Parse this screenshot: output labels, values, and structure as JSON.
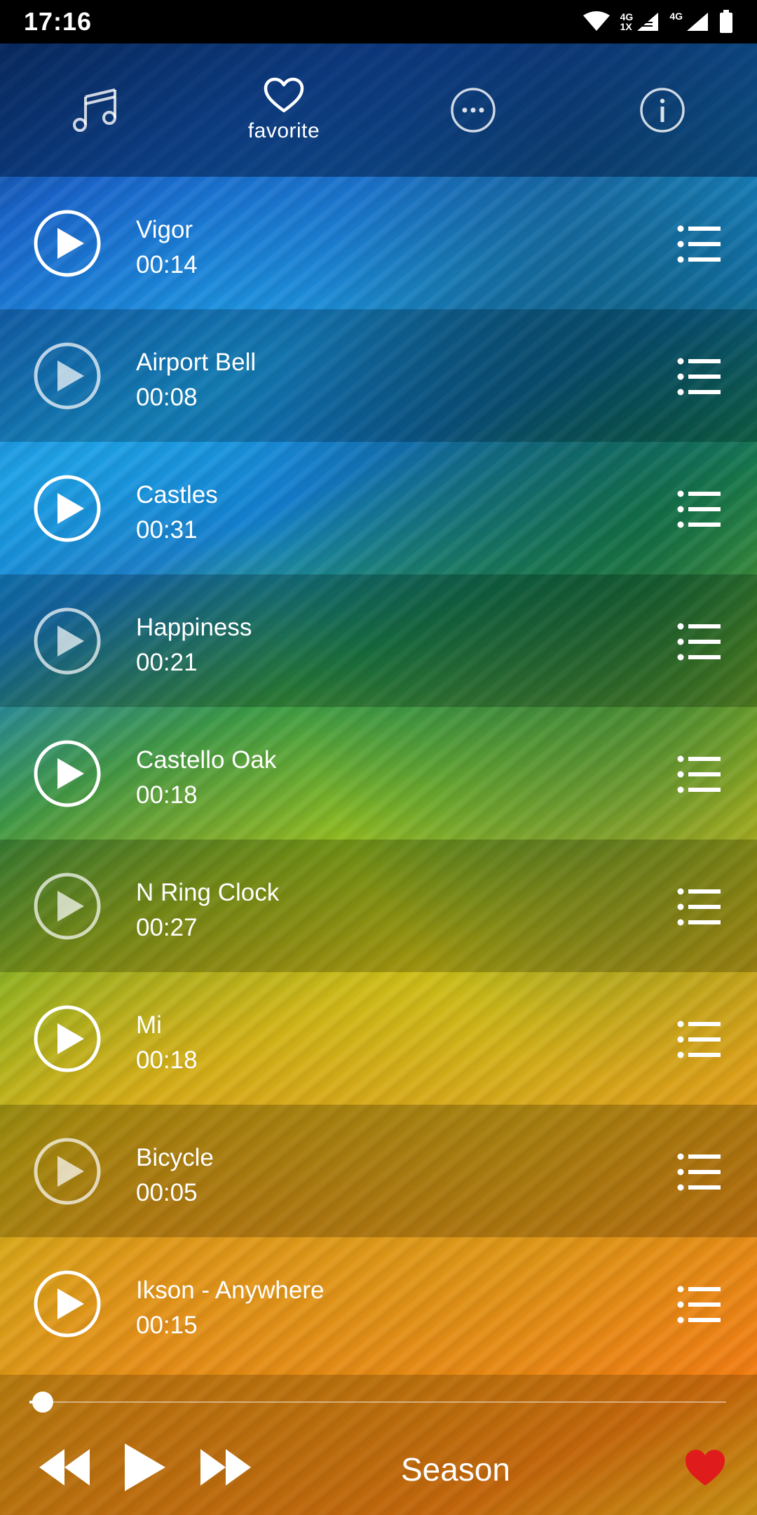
{
  "status_bar": {
    "time": "17:16",
    "network_1": "4G",
    "network_1_sub": "1X",
    "network_2": "4G",
    "icons": [
      "wifi-icon",
      "signal-icon",
      "signal-icon",
      "battery-icon"
    ]
  },
  "nav": {
    "items": [
      {
        "name": "music",
        "icon": "music-note-icon",
        "label": ""
      },
      {
        "name": "favorite",
        "icon": "heart-icon",
        "label": "favorite"
      },
      {
        "name": "more",
        "icon": "more-icon",
        "label": ""
      },
      {
        "name": "info",
        "icon": "info-icon",
        "label": ""
      }
    ]
  },
  "tracks": [
    {
      "title": "Vigor",
      "duration": "00:14"
    },
    {
      "title": "Airport Bell",
      "duration": "00:08"
    },
    {
      "title": "Castles",
      "duration": "00:31"
    },
    {
      "title": "Happiness",
      "duration": "00:21"
    },
    {
      "title": "Castello Oak",
      "duration": "00:18"
    },
    {
      "title": "N Ring Clock",
      "duration": "00:27"
    },
    {
      "title": "Mi",
      "duration": "00:18"
    },
    {
      "title": "Bicycle",
      "duration": "00:05"
    },
    {
      "title": "Ikson - Anywhere",
      "duration": "00:15"
    }
  ],
  "player": {
    "now_playing": "Season",
    "progress": 0.01,
    "favorite_color": "#e01b1b",
    "icons": [
      "rewind-icon",
      "play-icon",
      "fast-forward-icon",
      "heart-icon"
    ]
  }
}
